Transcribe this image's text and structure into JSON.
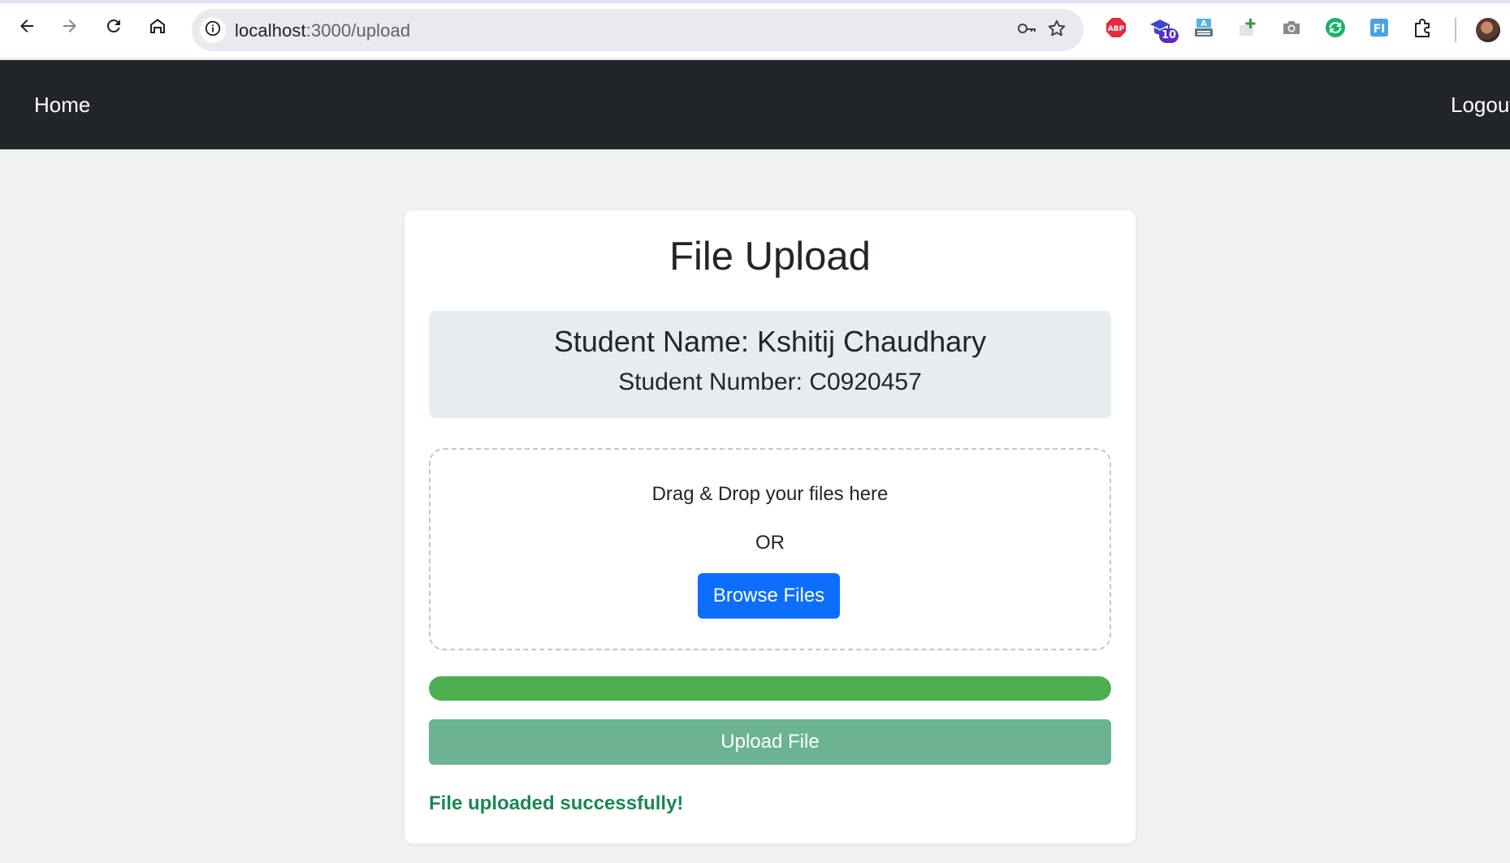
{
  "browser": {
    "url_host": "localhost",
    "url_path": ":3000/upload",
    "extension_badge": "10",
    "accent_color": "#e9dcf7"
  },
  "navbar": {
    "home_label": "Home",
    "logout_label": "Logout",
    "background": "#212529"
  },
  "page": {
    "title": "File Upload",
    "student_name": "Student Name: Kshitij Chaudhary",
    "student_number": "Student Number: C0920457"
  },
  "dropzone": {
    "drag_text": "Drag & Drop your files here",
    "or_text": "OR",
    "browse_label": "Browse Files"
  },
  "upload": {
    "progress_percent": 100,
    "progress_color": "#4caf50",
    "button_label": "Upload File",
    "status_message": "File uploaded successfully!",
    "status_color": "#198754"
  },
  "icons": {
    "back": "arrow-left-icon",
    "forward": "arrow-right-icon",
    "reload": "reload-icon",
    "home": "home-icon",
    "site_info": "info-icon",
    "password": "key-icon",
    "bookmark": "star-icon",
    "extensions": [
      "adblock-plus-icon",
      "graduation-cap-icon",
      "text-tool-icon",
      "add-tab-icon",
      "camera-icon",
      "refresh-circle-icon",
      "fi-icon",
      "puzzle-icon"
    ]
  }
}
